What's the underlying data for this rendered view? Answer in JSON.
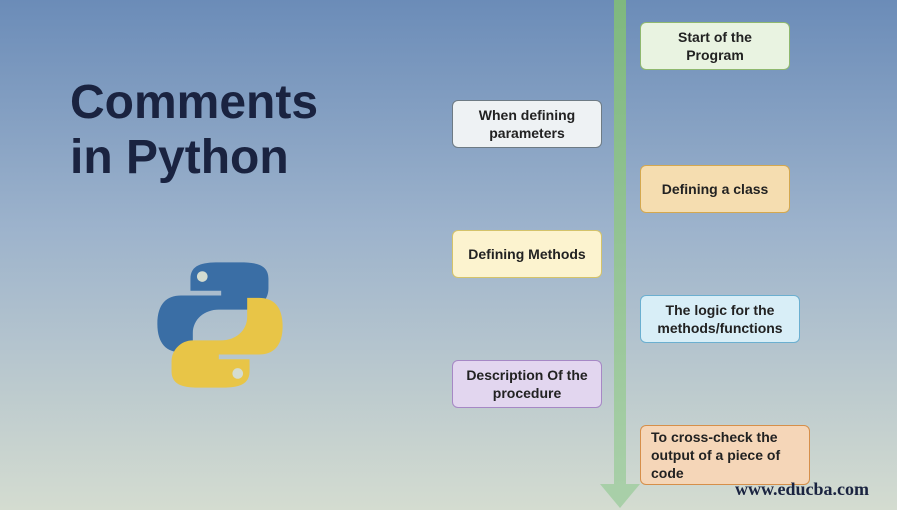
{
  "title_line1": "Comments",
  "title_line2": "in Python",
  "footer": "www.educba.com",
  "boxes": {
    "b1": "Start of the Program",
    "b2": "When defining parameters",
    "b3": "Defining a class",
    "b4": "Defining Methods",
    "b5": "The logic for the methods/functions",
    "b6": "Description Of the procedure",
    "b7": "To cross-check the output of a piece of code"
  }
}
